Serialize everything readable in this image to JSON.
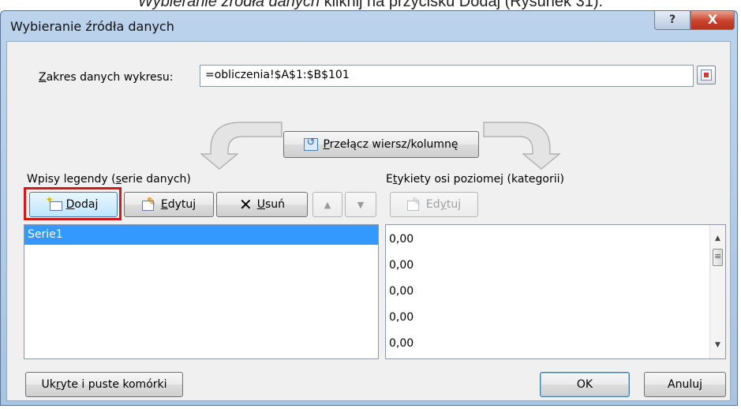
{
  "caption": {
    "before": "Wybieranie źródła danych",
    "after": " kliknij na przycisku Dodaj (Rysunek 31)."
  },
  "window": {
    "title": "Wybieranie źródła danych",
    "help_label": "?",
    "close_label": "X"
  },
  "range": {
    "label_accel": "Z",
    "label_rest": "akres danych wykresu:",
    "value": "=obliczenia!$A$1:$B$101"
  },
  "switch_button": {
    "accel": "P",
    "rest": "rzełącz wiersz/kolumnę"
  },
  "legend_section": {
    "label_pre": "Wpisy legendy (",
    "label_accel": "s",
    "label_post": "erie danych)",
    "add": {
      "accel": "D",
      "rest": "odaj"
    },
    "edit": {
      "accel": "E",
      "rest": "dytuj"
    },
    "remove": {
      "accel": "U",
      "rest": "suń"
    },
    "series": [
      "Serie1"
    ]
  },
  "axis_section": {
    "label_pre": "E",
    "label_accel": "t",
    "label_post": "ykiety osi poziomej (kategorii)",
    "edit": {
      "pre": "Ed",
      "accel": "y",
      "rest": "tuj"
    },
    "categories": [
      "0,00",
      "0,00",
      "0,00",
      "0,00",
      "0,00"
    ]
  },
  "footer": {
    "hidden_pre": "Uk",
    "hidden_accel": "r",
    "hidden_rest": "yte i puste komórki",
    "ok": "OK",
    "cancel": "Anuluj"
  },
  "colors": {
    "selection": "#3399ff",
    "highlight_border": "#d11a1a",
    "dialog_background": "#f0f0f0"
  },
  "icons": [
    "help-icon",
    "close-icon",
    "range-select-icon",
    "switch-row-column-icon",
    "add-icon",
    "edit-icon",
    "remove-icon",
    "move-up-icon",
    "move-down-icon"
  ]
}
